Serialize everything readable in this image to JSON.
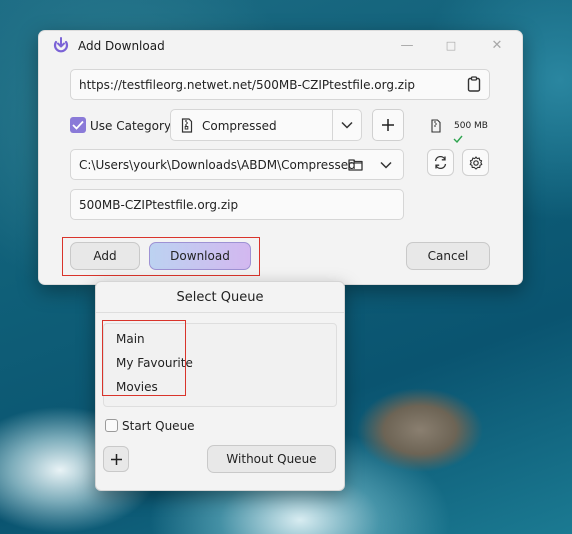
{
  "window": {
    "title": "Add Download"
  },
  "url": {
    "value": "https://testfileorg.netwet.net/500MB-CZIPtestfile.org.zip"
  },
  "category": {
    "checkbox_label": "Use Category",
    "selected": "Compressed"
  },
  "size": {
    "text": "500 MB"
  },
  "path": {
    "value": "C:\\Users\\yourk\\Downloads\\ABDM\\Compressed"
  },
  "filename": {
    "value": "500MB-CZIPtestfile.org.zip"
  },
  "buttons": {
    "add": "Add",
    "download": "Download",
    "cancel": "Cancel"
  },
  "queue_popup": {
    "title": "Select Queue",
    "queues": [
      "Main",
      "My Favourite",
      "Movies"
    ],
    "start_queue_label": "Start Queue",
    "without_queue": "Without Queue"
  },
  "colors": {
    "accent": "#8a7ad8",
    "download_btn_start": "#bcd2f1",
    "download_btn_end": "#d3b8f0",
    "highlight": "#d9342b"
  }
}
